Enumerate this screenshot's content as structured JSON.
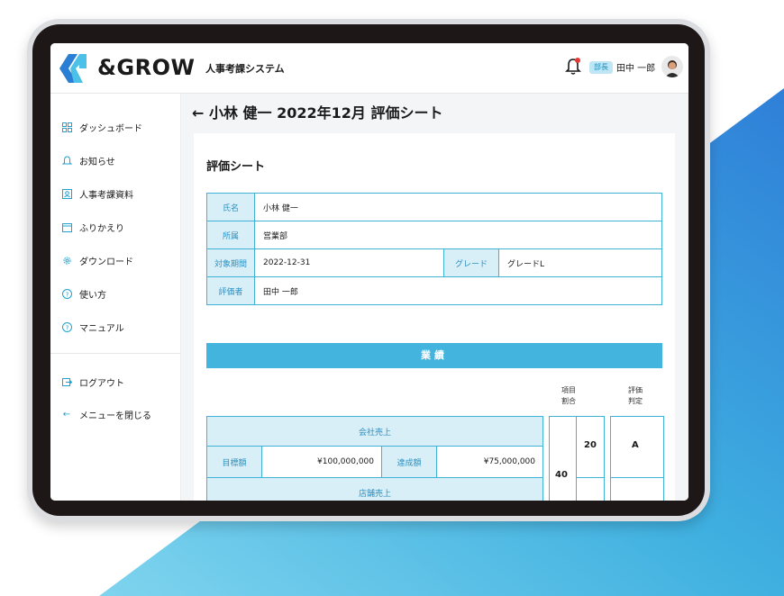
{
  "brand": {
    "logo_text": "&GROW",
    "app_name": "人事考課システム"
  },
  "header": {
    "role_badge": "部長",
    "user_name": "田中 一郎"
  },
  "sidebar": {
    "items": [
      {
        "label": "ダッシュボード",
        "icon": "dashboard-icon"
      },
      {
        "label": "お知らせ",
        "icon": "bell-icon"
      },
      {
        "label": "人事考課資料",
        "icon": "id-card-icon"
      },
      {
        "label": "ふりかえり",
        "icon": "calendar-icon"
      },
      {
        "label": "ダウンロード",
        "icon": "gear-icon"
      },
      {
        "label": "使い方",
        "icon": "help-icon"
      },
      {
        "label": "マニュアル",
        "icon": "help-icon"
      }
    ],
    "logout": "ログアウト",
    "close_menu": "メニューを閉じる"
  },
  "page": {
    "back_arrow": "←",
    "title": "小林 健一 2022年12月 評価シート",
    "card_title": "評価シート"
  },
  "info": {
    "name_label": "氏名",
    "name_value": "小林 健一",
    "dept_label": "所属",
    "dept_value": "営業部",
    "period_label": "対象期間",
    "period_value": "2022-12-31",
    "grade_label": "グレード",
    "grade_value": "グレードL",
    "evaluator_label": "評価者",
    "evaluator_value": "田中 一郎"
  },
  "performance": {
    "section_title": "業績",
    "col_ratio": "項目\n割合",
    "col_judgement": "評価\n判定",
    "company_sales_label": "会社売上",
    "target_label": "目標額",
    "target_value": "¥100,000,000",
    "achieved_label": "達成額",
    "achieved_value": "¥75,000,000",
    "store_sales_label": "店舗売上",
    "group_ratio": "40",
    "item_ratio": "20",
    "judgement": "A"
  },
  "colors": {
    "accent": "#42b4de",
    "label_bg": "#d8eff8",
    "label_text": "#2a8fc1",
    "device": "#1d1718"
  }
}
